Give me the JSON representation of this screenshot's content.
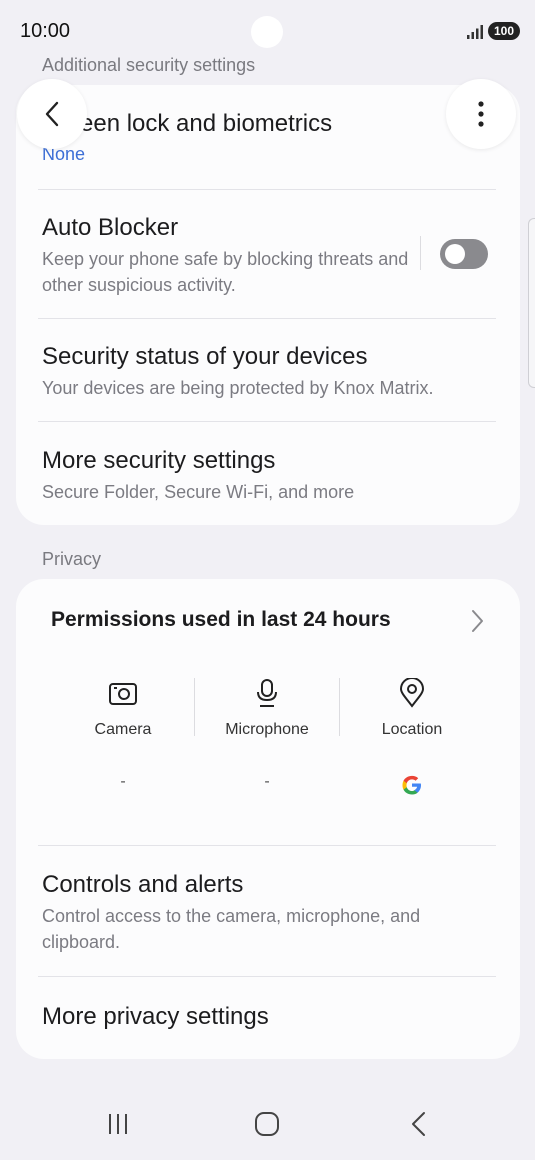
{
  "status_bar": {
    "time": "10:00",
    "battery": "100",
    "icons": [
      "signal-icon",
      "battery-icon"
    ]
  },
  "header": {
    "back_icon": "chevron-left-icon",
    "more_icon": "more-vertical-icon"
  },
  "security": {
    "section_label": "Additional security settings",
    "items": [
      {
        "title": "Screen lock and biometrics",
        "visible_title": "een lock and biometrics",
        "value": "None"
      },
      {
        "title": "Auto Blocker",
        "subtitle": "Keep your phone safe by blocking threats and other suspicious activity.",
        "toggle": "off"
      },
      {
        "title": "Security status of your devices",
        "subtitle": "Your devices are being protected by Knox Matrix."
      },
      {
        "title": "More security settings",
        "subtitle": "Secure Folder, Secure Wi-Fi, and more"
      }
    ]
  },
  "privacy": {
    "section_label": "Privacy",
    "permissions_title": "Permissions used in last 24 hours",
    "permissions": [
      {
        "label": "Camera",
        "icon": "camera-icon",
        "value": "-"
      },
      {
        "label": "Microphone",
        "icon": "microphone-icon",
        "value": "-"
      },
      {
        "label": "Location",
        "icon": "location-pin-icon",
        "value_icon": "google-g-icon"
      }
    ],
    "items": [
      {
        "title": "Controls and alerts",
        "subtitle": "Control access to the camera, microphone, and clipboard."
      },
      {
        "title": "More privacy settings"
      }
    ]
  },
  "nav_bar": {
    "icons": [
      "recent-apps-icon",
      "home-icon",
      "back-icon"
    ]
  },
  "colors": {
    "background": "#f1f0f5",
    "card": "#fcfcfd",
    "accent_link": "#3d6fd6",
    "toggle_off": "#8a8a8e"
  }
}
